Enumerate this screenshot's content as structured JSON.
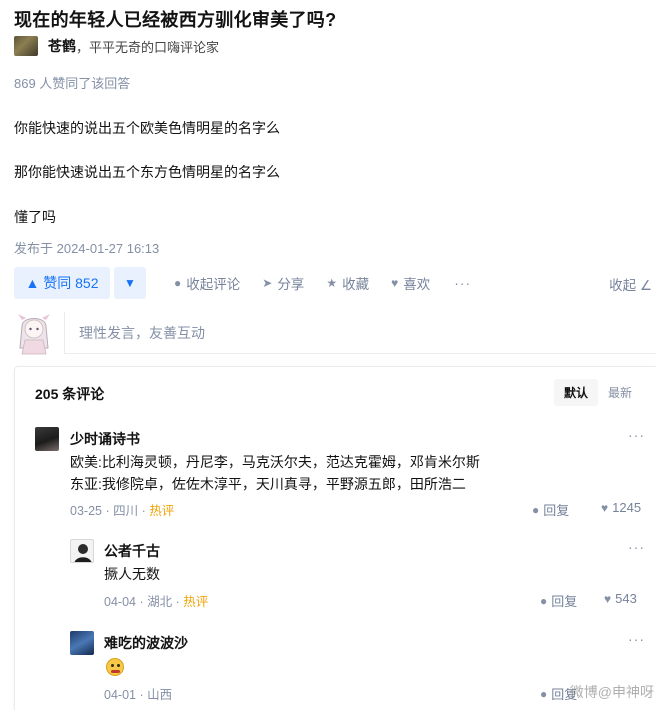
{
  "question": {
    "title": "现在的年轻人已经被西方驯化审美了吗?"
  },
  "author": {
    "name": "苍鹤",
    "bio": "，平平无奇的口嗨评论家"
  },
  "votes_note": "869 人赞同了该回答",
  "answer": {
    "lines": [
      "你能快速的说出五个欧美色情明星的名字么",
      "那你能快速说出五个东方色情明星的名字么",
      "懂了吗"
    ],
    "publish_time": "发布于 2024-01-27 16:13"
  },
  "actions": {
    "vote_up": "▲ 赞同 852",
    "vote_down": "▼",
    "items": [
      {
        "label": "收起评论",
        "icon": "comment-icon"
      },
      {
        "label": "分享",
        "icon": "share-icon"
      },
      {
        "label": "收藏",
        "icon": "star-icon"
      },
      {
        "label": "喜欢",
        "icon": "heart-icon"
      }
    ],
    "more": "···",
    "collapse": "收起 ∠"
  },
  "comment_input": {
    "placeholder": "理性发言，友善互动"
  },
  "comments": {
    "count_label": "205 条评论",
    "sort": [
      "默认",
      "最新"
    ],
    "list": [
      {
        "name": "少时诵诗书",
        "text_lines": [
          "欧美:比利海灵顿，丹尼李，马克沃尔夫，范达克霍姆，邓肯米尔斯",
          "东亚:我修院卓，佐佐木淳平，天川真寻，平野源五郎，田所浩二"
        ],
        "date": "03-25",
        "location": "四川",
        "hot": "热评",
        "reply": "回复",
        "likes": "1245"
      },
      {
        "name": "公者千古",
        "text_lines": [
          "撅人无数"
        ],
        "date": "04-04",
        "location": "湖北",
        "hot": "热评",
        "reply": "回复",
        "likes": "543"
      },
      {
        "name": "难吃的波波沙",
        "emoji": "angry-face-emoji",
        "date": "04-01",
        "location": "山西",
        "reply": "回复"
      }
    ]
  },
  "watermark": "微博@申神呀"
}
